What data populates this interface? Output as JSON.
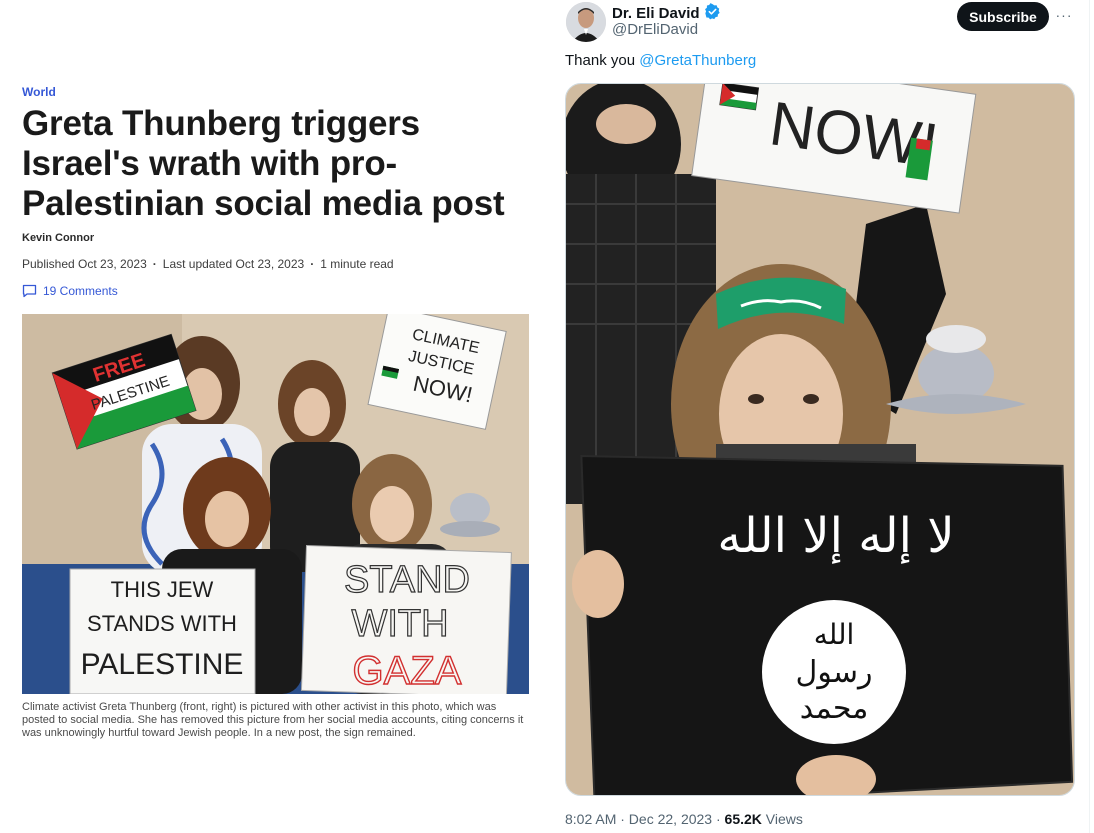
{
  "article": {
    "section": "World",
    "headline": "Greta Thunberg triggers Israel's wrath with pro-Palestinian social media post",
    "author": "Kevin Connor",
    "published": "Published Oct 23, 2023",
    "updated": "Last updated Oct 23, 2023",
    "read_time": "1 minute read",
    "comments": "19 Comments",
    "caption": "Climate activist Greta Thunberg (front, right) is pictured with other activist in this photo, which was posted to social media. She has removed this picture from her social media accounts, citing concerns it was unknowingly hurtful toward Jewish people. In a new post, the sign remained.",
    "photo_signs": {
      "free_palestine_1": "FREE",
      "free_palestine_2": "PALESTINE",
      "climate_1": "CLIMATE",
      "climate_2": "JUSTICE",
      "climate_3": "NOW!",
      "jew_1": "THIS JEW",
      "jew_2": "STANDS WITH",
      "jew_3": "PALESTINE",
      "gaza_1": "STAND",
      "gaza_2": "WITH",
      "gaza_3": "GAZA"
    }
  },
  "tweet": {
    "display_name": "Dr. Eli David",
    "handle": "@DrEliDavid",
    "subscribe_label": "Subscribe",
    "more_label": "···",
    "text_prefix": "Thank you ",
    "mention": "@GretaThunberg",
    "timestamp": "8:02 AM · Dec 22, 2023 · ",
    "views_count": "65.2K",
    "views_label": " Views",
    "photo_signs": {
      "now_sign": "NOW!",
      "flag_text_1": "لا إله إلا الله",
      "flag_text_2": "الله",
      "flag_text_3": "رسول",
      "flag_text_4": "محمد"
    }
  }
}
